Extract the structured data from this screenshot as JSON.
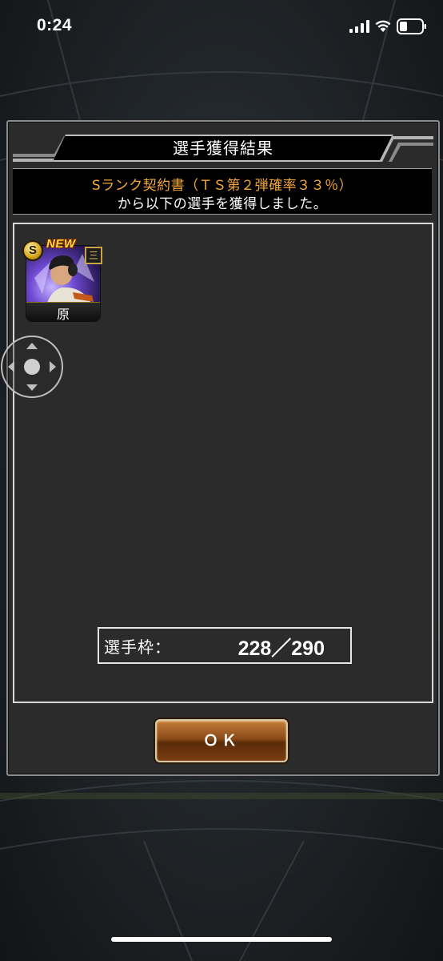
{
  "status_bar": {
    "time": "0:24"
  },
  "dialog": {
    "title": "選手獲得結果",
    "subtitle_line1": "Sランク契約書（ＴＳ第２弾確率３３％）",
    "subtitle_line2": "から以下の選手を獲得しました。",
    "player_card": {
      "new_tag": "NEW",
      "rank": "S",
      "position": "三",
      "name": "原"
    },
    "slot_label": "選手枠：",
    "slot_value": "228／290",
    "ok_label": "ＯＫ"
  },
  "colors": {
    "subtitle_accent": "#f4a73a",
    "button_brown": "#8a4a18",
    "dialog_bg": "#2b2b2b"
  },
  "icons": [
    "signal-icon",
    "wifi-icon",
    "battery-icon",
    "dpad-icon",
    "rank-badge-icon"
  ]
}
